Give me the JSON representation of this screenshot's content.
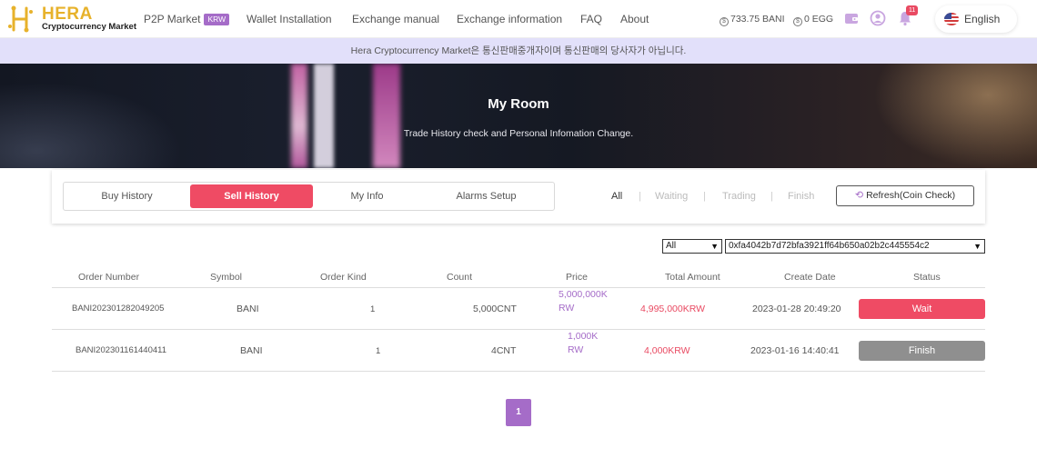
{
  "brand": {
    "name": "HERA",
    "subtitle": "Cryptocurrency Market",
    "color": "#e7b22b"
  },
  "nav": {
    "items": [
      {
        "label": "P2P Market",
        "badge": "KRW"
      },
      {
        "label": "Wallet Installation"
      },
      {
        "label": "Exchange manual"
      },
      {
        "label": "Exchange information"
      },
      {
        "label": "FAQ"
      },
      {
        "label": "About"
      }
    ]
  },
  "balances": {
    "bani": "733.75 BANI",
    "egg": "0 EGG"
  },
  "notifications": {
    "count": "11"
  },
  "language": {
    "label": "English"
  },
  "notice": {
    "text": "Hera Cryptocurrency Market은 통신판매중개자이며 통신판매의 당사자가 아닙니다."
  },
  "hero": {
    "title": "My Room",
    "subtitle": "Trade History check and Personal Infomation Change."
  },
  "tabs": [
    {
      "label": "Buy History",
      "active": false
    },
    {
      "label": "Sell History",
      "active": true
    },
    {
      "label": "My Info",
      "active": false
    },
    {
      "label": "Alarms Setup",
      "active": false
    }
  ],
  "filters": [
    {
      "label": "All",
      "active": true
    },
    {
      "label": "Waiting",
      "active": false
    },
    {
      "label": "Trading",
      "active": false
    },
    {
      "label": "Finish",
      "active": false
    }
  ],
  "refresh_label": "Refresh(Coin Check)",
  "selects": {
    "status": "All",
    "wallet": "0xfa4042b7d72bfa3921ff64b650a02b2c445554c2"
  },
  "table": {
    "columns": [
      "Order Number",
      "Symbol",
      "Order Kind",
      "Count",
      "Price",
      "Total Amount",
      "Create Date",
      "Status"
    ],
    "rows": [
      {
        "order_number": "BANI202301282049205",
        "symbol": "BANI",
        "order_kind": "1",
        "count": "5,000CNT",
        "price_line1": "5,000,000K",
        "price_line2": "RW",
        "total": "4,995,000KRW",
        "date": "2023-01-28 20:49:20",
        "status": "Wait",
        "status_color": "#ef4b64"
      },
      {
        "order_number": "BANI202301161440411",
        "symbol": "BANI",
        "order_kind": "1",
        "count": "4CNT",
        "price_line1": "1,000K",
        "price_line2": "RW",
        "total": "4,000KRW",
        "date": "2023-01-16 14:40:41",
        "status": "Finish",
        "status_color": "#8f8f8f"
      }
    ]
  },
  "pagination": {
    "current": "1"
  },
  "colors": {
    "accent": "#ef4b64",
    "purple": "#a56cc8",
    "notice_bg": "#e2e0fa"
  }
}
